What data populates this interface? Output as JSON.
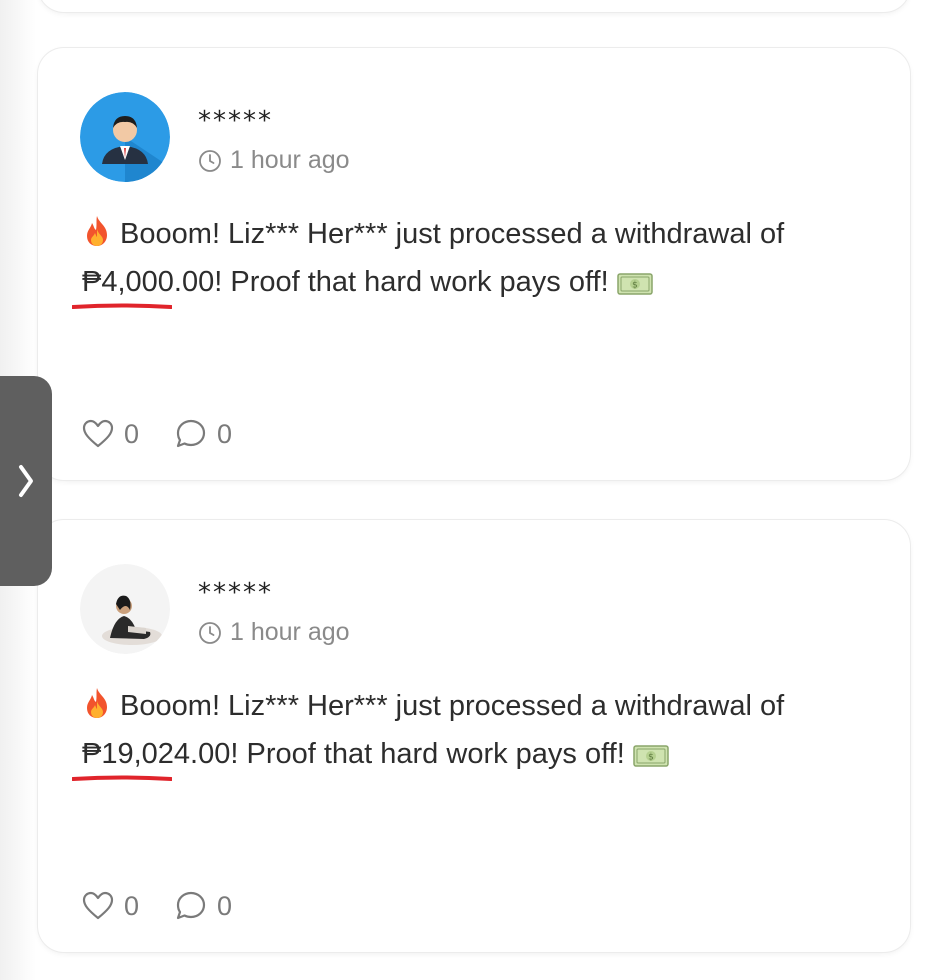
{
  "posts": [
    {
      "username": "*****",
      "time": "1 hour ago",
      "text_before": " Booom! Liz*** Her*** just processed a withdrawal of ",
      "amount": "₱4,000.00",
      "text_after": "! Proof that hard work pays off! ",
      "likes": "0",
      "comments": "0"
    },
    {
      "username": "*****",
      "time": "1 hour ago",
      "text_before": " Booom! Liz*** Her*** just processed a withdrawal of ",
      "amount": "₱19,024.00",
      "text_after": "! Proof that hard work pays off! ",
      "likes": "0",
      "comments": "0"
    }
  ],
  "side_tab": {
    "icon": "chevron-right-icon"
  },
  "colors": {
    "underline": "#e0242b",
    "avatar_bg": "#2c9be6",
    "side_tab": "#5f5f5f"
  }
}
